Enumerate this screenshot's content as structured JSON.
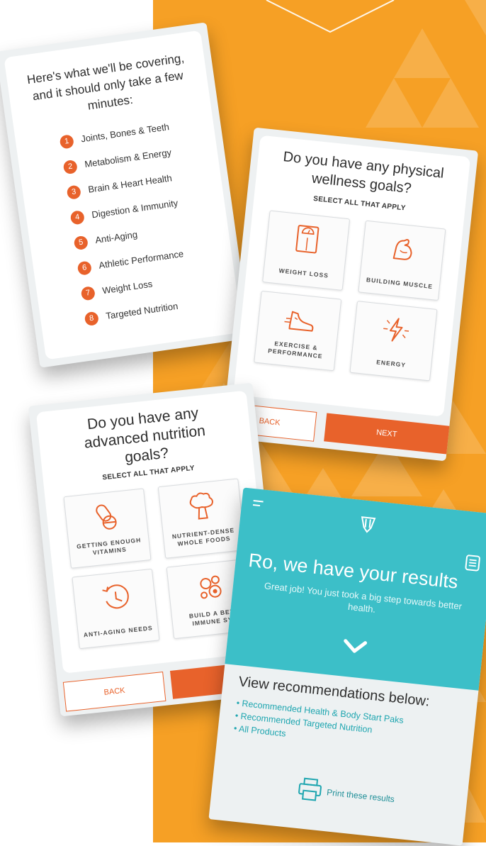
{
  "card_topics": {
    "title_lines": [
      "Here's what we'll be covering,",
      "and it should only take a few",
      "minutes:"
    ],
    "items": [
      {
        "num": "1",
        "label": "Joints, Bones & Teeth"
      },
      {
        "num": "2",
        "label": "Metabolism & Energy"
      },
      {
        "num": "3",
        "label": "Brain & Heart Health"
      },
      {
        "num": "4",
        "label": "Digestion & Immunity"
      },
      {
        "num": "5",
        "label": "Anti-Aging"
      },
      {
        "num": "6",
        "label": "Athletic Performance"
      },
      {
        "num": "7",
        "label": "Weight Loss"
      },
      {
        "num": "8",
        "label": "Targeted Nutrition"
      }
    ]
  },
  "card_physical": {
    "title_lines": [
      "Do you have any physical",
      "wellness goals?"
    ],
    "subtitle": "SELECT ALL THAT APPLY",
    "options": [
      {
        "label": "WEIGHT LOSS",
        "icon": "scale-icon"
      },
      {
        "label": "BUILDING MUSCLE",
        "icon": "flexed-arm-icon"
      },
      {
        "label": "EXERCISE & PERFORMANCE",
        "icon": "running-shoe-icon"
      },
      {
        "label": "ENERGY",
        "icon": "lightning-bolt-icon"
      }
    ],
    "back_label": "BACK",
    "next_label": "NEXT"
  },
  "card_nutrition": {
    "title_lines": [
      "Do you have any",
      "advanced nutrition",
      "goals?"
    ],
    "subtitle": "SELECT ALL THAT APPLY",
    "options": [
      {
        "label": "GETTING ENOUGH VITAMINS",
        "icon": "pills-icon"
      },
      {
        "label": "NUTRIENT-DENSE WHOLE FOODS",
        "icon": "broccoli-icon"
      },
      {
        "label": "ANTI-AGING NEEDS",
        "icon": "clock-icon"
      },
      {
        "label": "BUILD A BET IMMUNE SY",
        "icon": "cells-icon"
      }
    ],
    "back_label": "BACK"
  },
  "card_results": {
    "heading": "Ro, we have your results",
    "subtext": "Great job! You just took a big step towards better health.",
    "recommend_heading": "View recommendations below:",
    "links": [
      "Recommended Health & Body Start Paks",
      "Recommended Targeted Nutrition",
      "All Products"
    ],
    "print_label": "Print these results"
  },
  "colors": {
    "orange_bg": "#f6a025",
    "accent": "#e8622b",
    "teal": "#3cbfc8",
    "link": "#1fa6b0"
  }
}
